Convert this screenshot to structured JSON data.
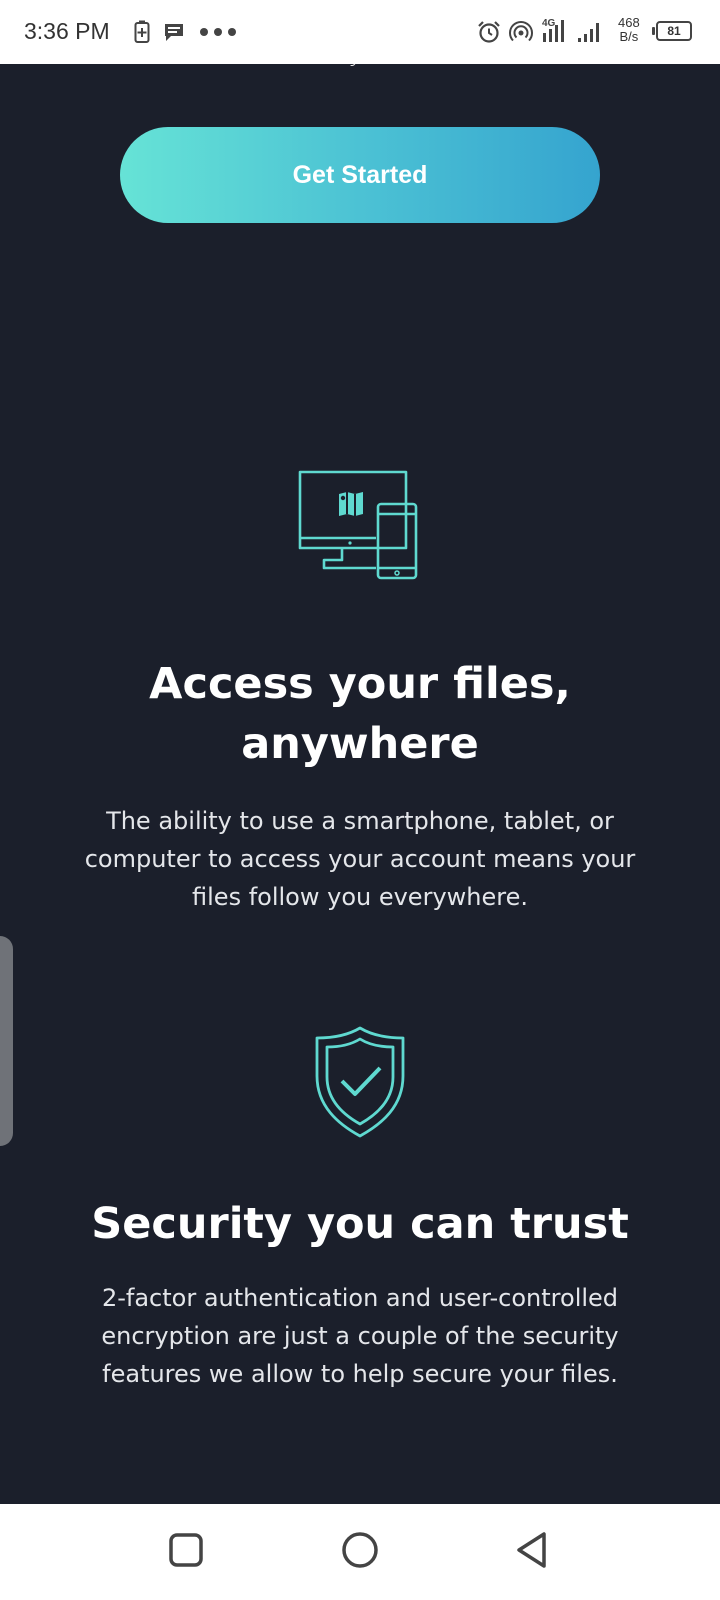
{
  "status_bar": {
    "time": "3:36 PM",
    "network_speed_value": "468",
    "network_speed_unit": "B/s",
    "network_type": "4G",
    "battery_level": "81",
    "icons": [
      "battery-saver-icon",
      "message-icon",
      "more-dots-icon",
      "alarm-icon",
      "hotspot-icon",
      "signal-4g-icon",
      "signal-icon",
      "battery-icon"
    ]
  },
  "page": {
    "clipped_text": "y,",
    "cta_label": "Get Started",
    "features": [
      {
        "icon": "devices-icon",
        "title": "Access your files, anywhere",
        "description": "The ability to use a smartphone, tablet, or computer to access your account means your files follow you everywhere."
      },
      {
        "icon": "shield-check-icon",
        "title": "Security you can trust",
        "description": "2-factor authentication and user-controlled encryption are just a couple of the security features we allow to help secure your files."
      }
    ]
  },
  "nav_bar": {
    "buttons": [
      "recents-button",
      "home-button",
      "back-button"
    ]
  },
  "colors": {
    "background": "#1b1f2b",
    "accent": "#5fd9d0",
    "gradient_start": "#66e3d6",
    "gradient_end": "#35a4cf",
    "text": "#ffffff"
  }
}
